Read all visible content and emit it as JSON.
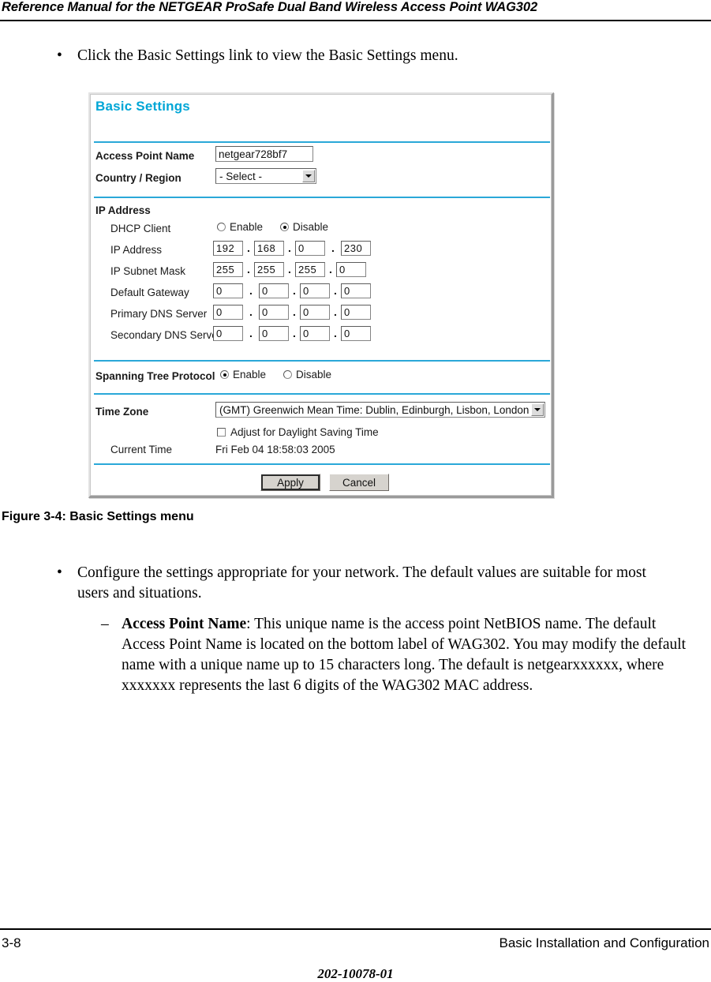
{
  "page": {
    "header_title": "Reference Manual for the NETGEAR ProSafe Dual Band Wireless Access Point WAG302",
    "bullet_mark": "•",
    "dash_mark": "–",
    "bullet_click": "Click the Basic Settings link to view the Basic Settings menu.",
    "figure_caption": "Figure 3-4: Basic Settings menu",
    "bullet_configure": "Configure the settings appropriate for your network. The default values are suitable for most users and situations.",
    "ap_name_term": "Access Point Name",
    "ap_name_desc": ": This unique name is the access point NetBIOS name. The default Access Point Name is located on the bottom label of WAG302. You may modify the default name with a unique name up to 15 characters long. The default is netgearxxxxxx, where xxxxxxx represents the last 6 digits of the WAG302 MAC address.",
    "footer_page": "3-8",
    "footer_section": "Basic Installation and Configuration",
    "footer_docnum": "202-10078-01"
  },
  "screenshot": {
    "panel_title": "Basic Settings",
    "accent_color": "#00a6d6",
    "divider_color": "#2aa8d8",
    "general": {
      "ap_name_label": "Access Point Name",
      "ap_name_value": "netgear728bf7",
      "country_label": "Country / Region",
      "country_value": "- Select -"
    },
    "ip_address": {
      "section_label": "IP Address",
      "dhcp_label": "DHCP Client",
      "dhcp_enable_label": "Enable",
      "dhcp_disable_label": "Disable",
      "dhcp_selected": "Disable",
      "rows": [
        {
          "label": "IP Address",
          "octets": [
            "192",
            "168",
            "0",
            "230"
          ]
        },
        {
          "label": "IP Subnet Mask",
          "octets": [
            "255",
            "255",
            "255",
            "0"
          ]
        },
        {
          "label": "Default Gateway",
          "octets": [
            "0",
            "0",
            "0",
            "0"
          ]
        },
        {
          "label": "Primary DNS Server",
          "octets": [
            "0",
            "0",
            "0",
            "0"
          ]
        },
        {
          "label": "Secondary DNS Server",
          "octets": [
            "0",
            "0",
            "0",
            "0"
          ]
        }
      ]
    },
    "stp": {
      "label": "Spanning Tree Protocol",
      "enable_label": "Enable",
      "disable_label": "Disable",
      "selected": "Enable"
    },
    "time": {
      "timezone_label": "Time Zone",
      "timezone_value": "(GMT) Greenwich Mean Time: Dublin, Edinburgh, Lisbon, London",
      "dst_label": "Adjust for Daylight Saving Time",
      "dst_checked": false,
      "current_time_label": "Current Time",
      "current_time_value": "Fri Feb 04 18:58:03 2005"
    },
    "buttons": {
      "apply_label": "Apply",
      "cancel_label": "Cancel"
    }
  }
}
